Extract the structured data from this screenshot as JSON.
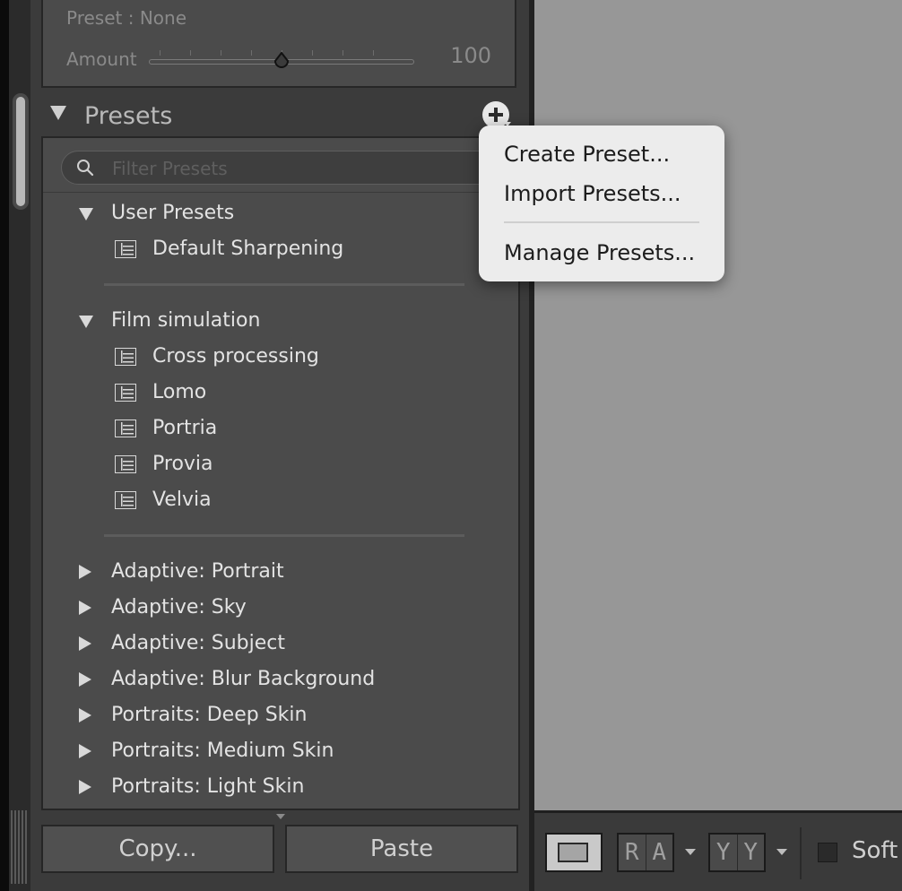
{
  "detail": {
    "preset_label": "Preset : None",
    "amount_label": "Amount",
    "amount_value": "100"
  },
  "presets_panel": {
    "title": "Presets",
    "filter_placeholder": "Filter Presets",
    "groups": [
      {
        "name": "User Presets",
        "expanded": true,
        "items": [
          "Default Sharpening"
        ]
      },
      {
        "name": "Film simulation",
        "expanded": true,
        "items": [
          "Cross processing",
          "Lomo",
          "Portria",
          "Provia",
          "Velvia"
        ]
      },
      {
        "name": "Adaptive: Portrait",
        "expanded": false
      },
      {
        "name": "Adaptive: Sky",
        "expanded": false
      },
      {
        "name": "Adaptive: Subject",
        "expanded": false
      },
      {
        "name": "Adaptive: Blur Background",
        "expanded": false
      },
      {
        "name": "Portraits: Deep Skin",
        "expanded": false
      },
      {
        "name": "Portraits: Medium Skin",
        "expanded": false
      },
      {
        "name": "Portraits: Light Skin",
        "expanded": false
      }
    ]
  },
  "bottom_buttons": {
    "copy": "Copy...",
    "paste": "Paste"
  },
  "toolbar": {
    "group1": [
      "R",
      "A"
    ],
    "group2": [
      "Y",
      "Y"
    ],
    "soft_label": "Soft"
  },
  "menu": {
    "items": [
      "Create Preset...",
      "Import Presets...",
      "Manage Presets..."
    ]
  }
}
